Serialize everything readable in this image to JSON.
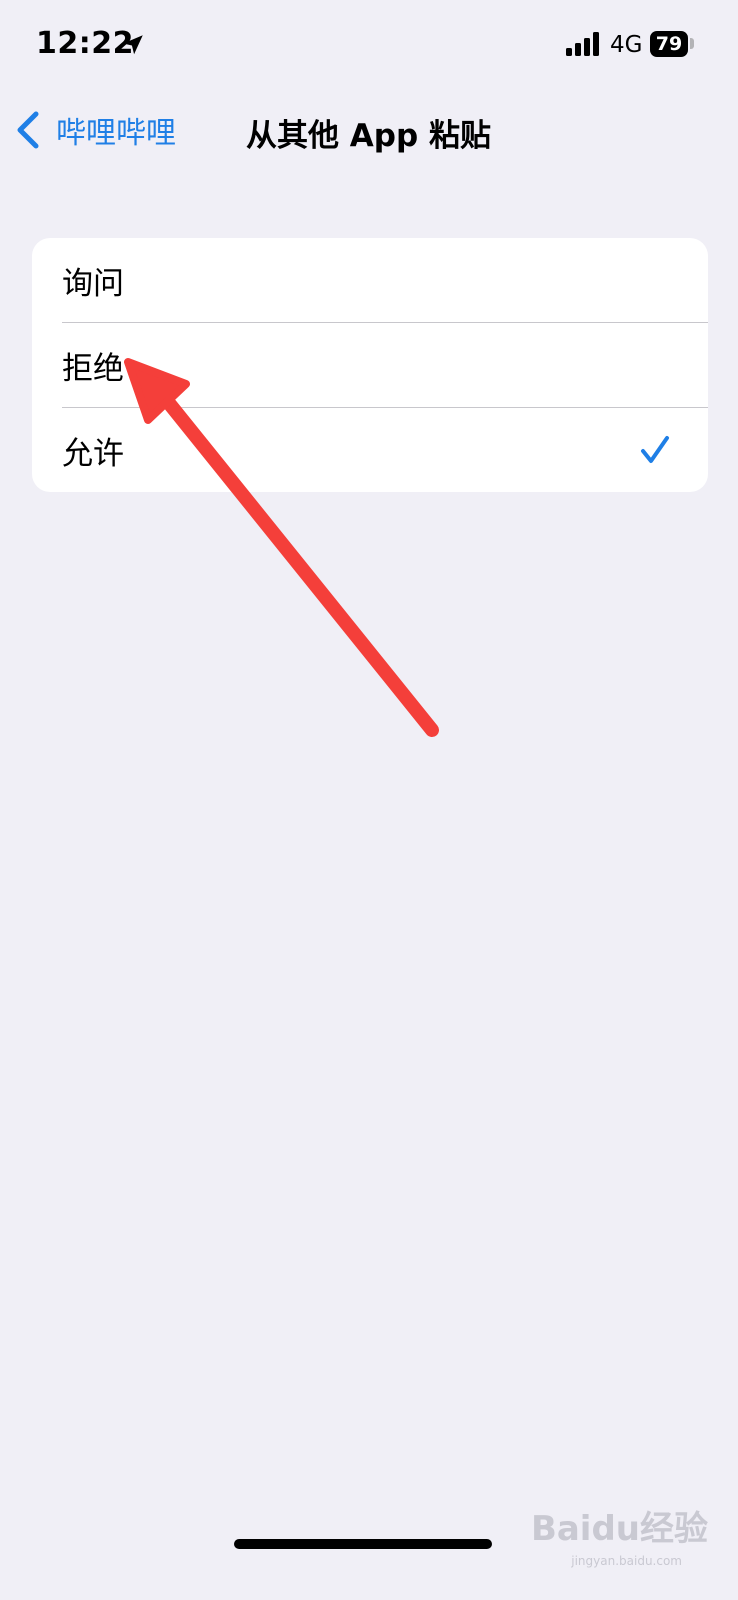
{
  "status_bar": {
    "time": "12:22",
    "location_icon": "location-arrow-icon",
    "signal_icon": "cellular-signal-icon",
    "network": "4G",
    "battery_level": "79"
  },
  "nav": {
    "back_label": "哔哩哔哩",
    "back_icon": "chevron-left-icon",
    "title": "从其他 App 粘贴"
  },
  "options": [
    {
      "label": "询问",
      "selected": false
    },
    {
      "label": "拒绝",
      "selected": false
    },
    {
      "label": "允许",
      "selected": true
    }
  ],
  "annotation": {
    "type": "arrow",
    "color": "#f43f3a"
  },
  "watermark": {
    "brand": "Baidu经验",
    "url": "jingyan.baidu.com"
  },
  "colors": {
    "accent": "#1f7fe6",
    "background": "#f0eff6"
  }
}
